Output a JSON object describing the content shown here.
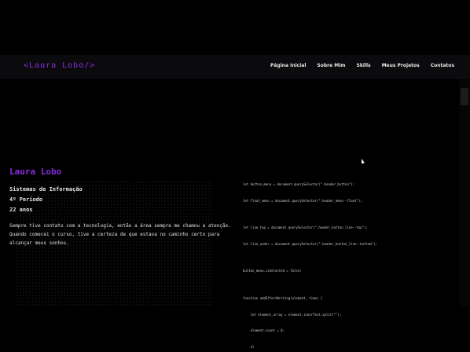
{
  "header": {
    "logo": "<Laura Lobo/>",
    "nav": [
      {
        "label": "Página Inicial"
      },
      {
        "label": "Sobre Mim"
      },
      {
        "label": "Skills"
      },
      {
        "label": "Meus Projetos"
      },
      {
        "label": "Contatos"
      }
    ]
  },
  "hero": {
    "name": "Laura Lobo",
    "course": "Sistemas de Informação",
    "period": "4º Período",
    "age": "22 anos",
    "bio": "Sempre tive contato com a tecnologia, então a área sempre me chamou a atenção. Quando comecei o curso, tive a certeza de que estava no caminho certo para alcançar meus sonhos."
  },
  "code": {
    "lines": [
      "let button_menu = document.querySelector(\".header_button\");",
      "let float_menu = document.querySelector(\".header_menu--float\");",
      "",
      "let line_top = document.querySelector(\".header_button_line--top\");",
      "let line_under = document.querySelector(\".header_button_line--bottom\");",
      "",
      "button_menu.isSelected = false;",
      "",
      "function addEffectWriting(element, time) {",
      "    let element_array = element.innerText.split(\"\");",
      "    element.count = 0;",
      "    el"
    ]
  },
  "colors": {
    "accent": "#8a2be2",
    "background": "#000000",
    "header_bg": "#0b0b0d"
  }
}
